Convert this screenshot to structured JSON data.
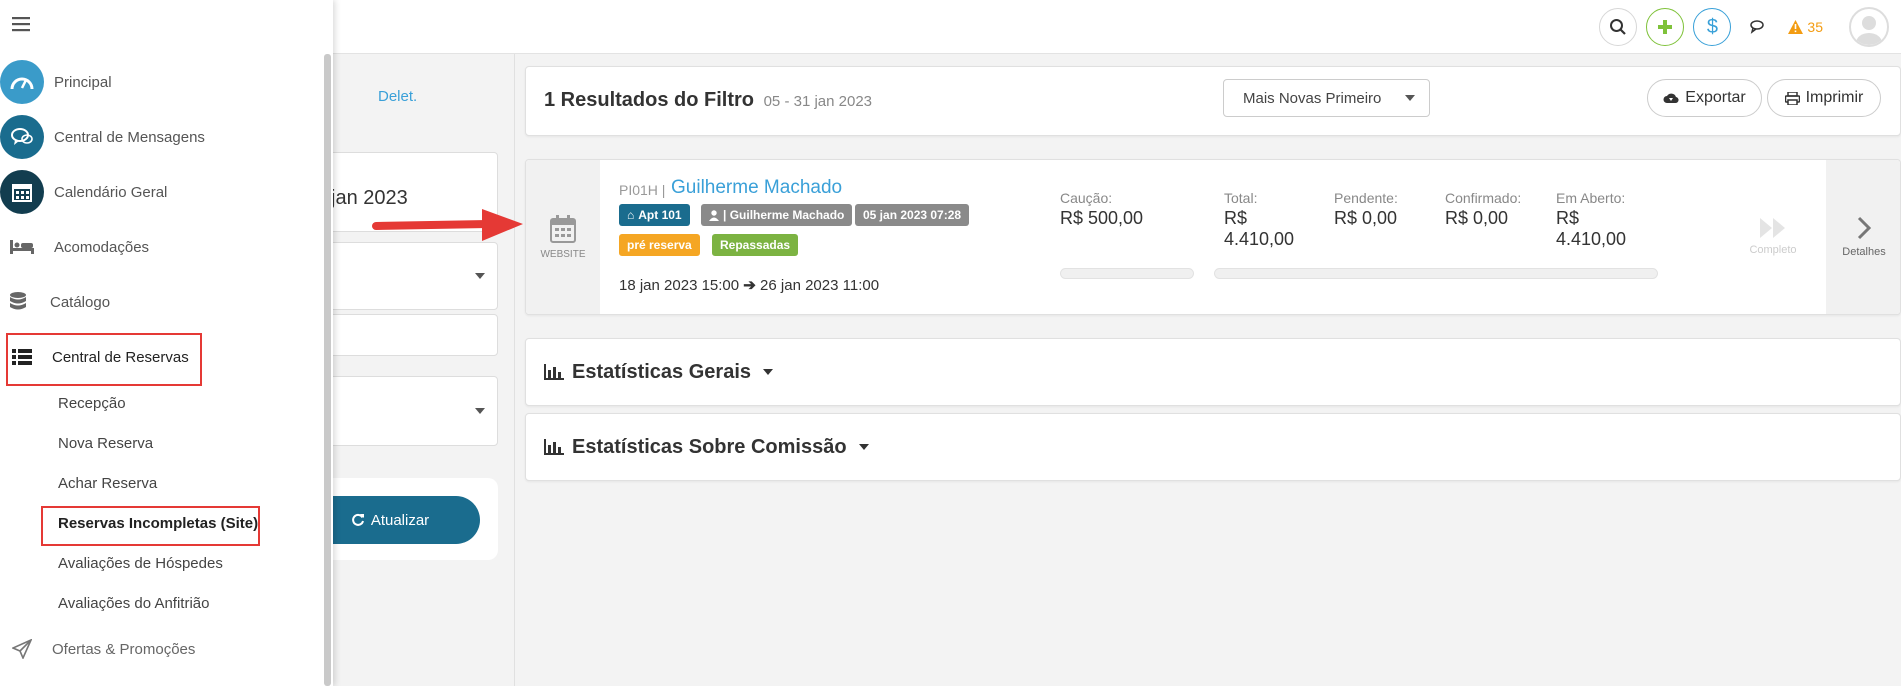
{
  "topbar": {
    "alerts_count": "35"
  },
  "filters": {
    "delet_label": "Delet.",
    "date_value": "jan 2023",
    "refresh_label": "Atualizar"
  },
  "results": {
    "title": "1 Resultados do Filtro",
    "range": "05 - 31 jan 2023",
    "sort_value": "Mais Novas Primeiro",
    "export_label": "Exportar",
    "print_label": "Imprimir"
  },
  "booking": {
    "source_label": "WEBSITE",
    "code": "PI01H |",
    "guest_name": "Guilherme Machado",
    "tag_unit": "Apt 101",
    "tag_guest": "| Guilherme Machado",
    "tag_created": "05 jan 2023 07:28",
    "tag_status": "pré reserva",
    "tag_transfer": "Repassadas",
    "checkin": "18 jan 2023 15:00",
    "checkout": "26 jan 2023 11:00",
    "caucao_label": "Caução:",
    "caucao_value": "R$ 500,00",
    "total_label": "Total:",
    "total_value_1": "R$",
    "total_value_2": "4.410,00",
    "pendente_label": "Pendente:",
    "pendente_value": "R$ 0,00",
    "confirmado_label": "Confirmado:",
    "confirmado_value": "R$ 0,00",
    "aberto_label": "Em Aberto:",
    "aberto_value_1": "R$",
    "aberto_value_2": "4.410,00",
    "complete_label": "Completo",
    "details_label": "Detalhes"
  },
  "stats": {
    "general_title": "Estatísticas Gerais",
    "commission_title": "Estatísticas Sobre Comissão"
  },
  "sidebar": {
    "items": [
      {
        "label": "Principal",
        "icon": "dashboard-icon"
      },
      {
        "label": "Central de Mensagens",
        "icon": "chat-icon"
      },
      {
        "label": "Calendário Geral",
        "icon": "calendar-icon"
      },
      {
        "label": "Acomodações",
        "icon": "bed-icon"
      },
      {
        "label": "Catálogo",
        "icon": "database-icon"
      },
      {
        "label": "Central de Reservas",
        "icon": "list-icon"
      }
    ],
    "subitems": [
      "Recepção",
      "Nova Reserva",
      "Achar Reserva",
      "Reservas Incompletas (Site)",
      "Avaliações de Hóspedes",
      "Avaliações do Anfitrião"
    ],
    "last_item": "Ofertas & Promoções"
  },
  "colors": {
    "accent": "#3aa0d8",
    "brand_dark": "#1a6c8e",
    "highlight_box": "#e53935",
    "tag_dark": "#1a6c8e",
    "tag_gray": "#8a8a8a",
    "tag_orange": "#f5a623",
    "tag_green": "#7cb342"
  }
}
